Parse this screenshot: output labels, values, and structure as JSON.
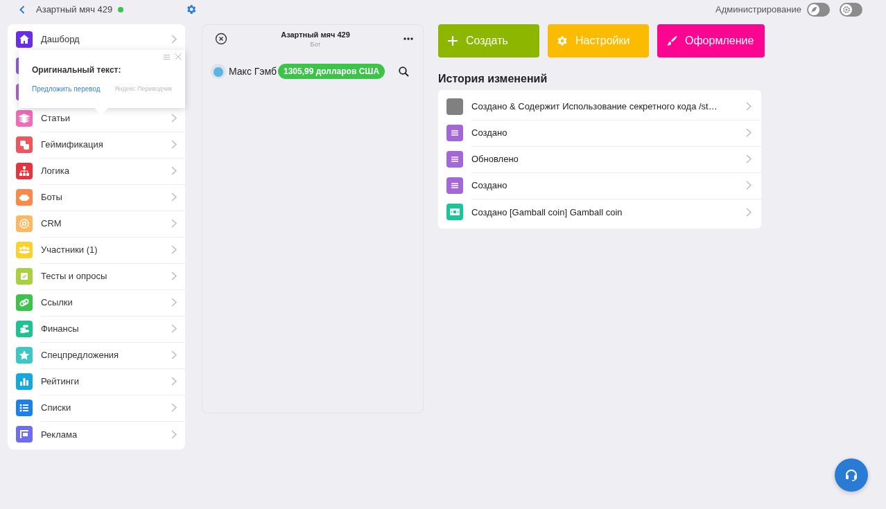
{
  "header": {
    "project": "Азартный мяч 429",
    "online": true,
    "admin_label": "Администрирование",
    "toggles": [
      {
        "on": false
      },
      {
        "on": false
      }
    ]
  },
  "sidebar": {
    "items": [
      {
        "label": "Дашборд",
        "color": "#6a2ee8"
      },
      {
        "color": "#8b5cf6"
      },
      {
        "color": "#b064d0"
      },
      {
        "label": "Статьи",
        "color": "#f06bb8"
      },
      {
        "label": "Геймификация",
        "color": "#f0555e"
      },
      {
        "label": "Логика",
        "color": "#e8323c"
      },
      {
        "label": "Боты",
        "color": "#fa8a4a"
      },
      {
        "label": "CRM",
        "color": "#fdb860"
      },
      {
        "label": "Участники (1)",
        "color": "#fdd02a"
      },
      {
        "label": "Тесты и опросы",
        "color": "#a8d040"
      },
      {
        "label": "Ссылки",
        "color": "#3cc34a"
      },
      {
        "label": "Финансы",
        "color": "#1ec490"
      },
      {
        "label": "Спецпредложения",
        "color": "#3cc6c8"
      },
      {
        "label": "Рейтинги",
        "color": "#14a8e0"
      },
      {
        "label": "Списки",
        "color": "#1a80f0"
      },
      {
        "label": "Реклама",
        "color": "#6c6cf4"
      }
    ]
  },
  "translate_popup": {
    "title": "Оригинальный текст:",
    "link": "Предложить перевод",
    "brand": "Яндекс Переводчик"
  },
  "chat": {
    "title": "Азартный мяч 429",
    "subtitle": "Бот",
    "user": "Макс Гэмб",
    "balance": "1305,99 долларов США"
  },
  "actions": [
    {
      "label": "Создать",
      "color": "#8db600"
    },
    {
      "label": "Настройки",
      "color": "#fbbb00"
    },
    {
      "label": "Оформление",
      "color": "#fc0591"
    }
  ],
  "history": {
    "title": "История изменений",
    "items": [
      {
        "text": "Создано & Содержит Использование секретного кода /st…",
        "color": "#808080"
      },
      {
        "text": "Создано",
        "color": "#a367d8"
      },
      {
        "text": "Обновлено",
        "color": "#a367d8"
      },
      {
        "text": "Создано",
        "color": "#a367d8"
      },
      {
        "text": "Создано [Gamball coin] Gamball coin",
        "color": "#17c798"
      }
    ]
  }
}
